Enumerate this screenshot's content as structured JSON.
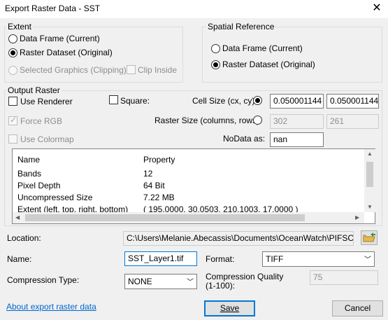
{
  "window": {
    "title": "Export Raster Data - SST",
    "close_glyph": "✕"
  },
  "extent": {
    "legend": "Extent",
    "data_frame": "Data Frame (Current)",
    "raster_dataset": "Raster Dataset (Original)",
    "selected_graphics": "Selected Graphics (Clipping)",
    "clip_inside": "Clip Inside"
  },
  "spatial_reference": {
    "legend": "Spatial Reference",
    "data_frame": "Data Frame (Current)",
    "raster_dataset": "Raster Dataset (Original)"
  },
  "output_raster": {
    "legend": "Output Raster",
    "use_renderer": "Use Renderer",
    "square": "Square:",
    "cell_size_label": "Cell Size (cx, cy):",
    "cell_size_x": "0.050001144",
    "cell_size_y": "0.050001144",
    "force_rgb": "Force RGB",
    "raster_size_label": "Raster Size (columns, rows):",
    "columns": "302",
    "rows": "261",
    "use_colormap": "Use Colormap",
    "nodata_label": "NoData as:",
    "nodata_value": "nan"
  },
  "properties": {
    "headers": [
      "Name",
      "Property"
    ],
    "rows": [
      [
        "Bands",
        "12"
      ],
      [
        "Pixel Depth",
        "64 Bit"
      ],
      [
        "Uncompressed Size",
        "7.22 MB"
      ],
      [
        "Extent (left, top, right, bottom)",
        "( 195.0000, 30.0503, 210.1003, 17.0000 )"
      ]
    ]
  },
  "location": {
    "label": "Location:",
    "value": "C:\\Users\\Melanie.Abecassis\\Documents\\OceanWatch\\PIFSC-satelli"
  },
  "name": {
    "label": "Name:",
    "value": "SST_Layer1.tif"
  },
  "format": {
    "label": "Format:",
    "value": "TIFF"
  },
  "compression_type": {
    "label": "Compression Type:",
    "value": "NONE"
  },
  "compression_quality": {
    "label_line1": "Compression Quality",
    "label_line2": "(1-100):",
    "value": "75"
  },
  "footer": {
    "about_link": "About export raster data",
    "save": "Save",
    "cancel": "Cancel"
  }
}
